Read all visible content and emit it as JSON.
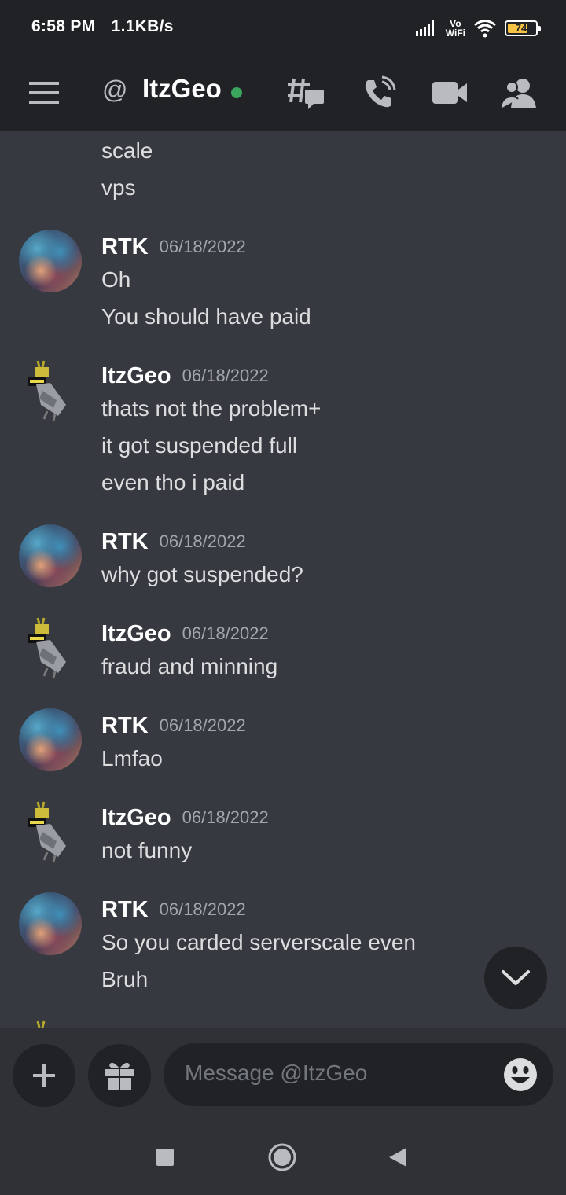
{
  "status_bar": {
    "time": "6:58 PM",
    "speed": "1.1KB/s",
    "volte_top": "Vo",
    "volte_bottom": "WiFi",
    "battery": "74",
    "battery_level": 0.74
  },
  "header": {
    "at_symbol": "@",
    "title": "ItzGeo",
    "status": "online"
  },
  "messages": {
    "continued": [
      "scale",
      "vps"
    ],
    "groups": [
      {
        "author": "RTK",
        "time": "06/18/2022",
        "lines": [
          "Oh",
          "You should have paid"
        ]
      },
      {
        "author": "ItzGeo",
        "time": "06/18/2022",
        "lines": [
          "thats not the problem+",
          "it got suspended full",
          "even tho i paid"
        ]
      },
      {
        "author": "RTK",
        "time": "06/18/2022",
        "lines": [
          "why got suspended?"
        ]
      },
      {
        "author": "ItzGeo",
        "time": "06/18/2022",
        "lines": [
          "fraud and minning"
        ]
      },
      {
        "author": "RTK",
        "time": "06/18/2022",
        "lines": [
          "Lmfao"
        ]
      },
      {
        "author": "ItzGeo",
        "time": "06/18/2022",
        "lines": [
          "not funny"
        ]
      },
      {
        "author": "RTK",
        "time": "06/18/2022",
        "lines": [
          "So you carded serverscale even",
          "Bruh"
        ]
      }
    ]
  },
  "composer": {
    "placeholder": "Message @ItzGeo"
  },
  "colors": {
    "background": "#36393f",
    "header": "#202225",
    "online": "#3ba55d",
    "battery": "#f6c342"
  }
}
